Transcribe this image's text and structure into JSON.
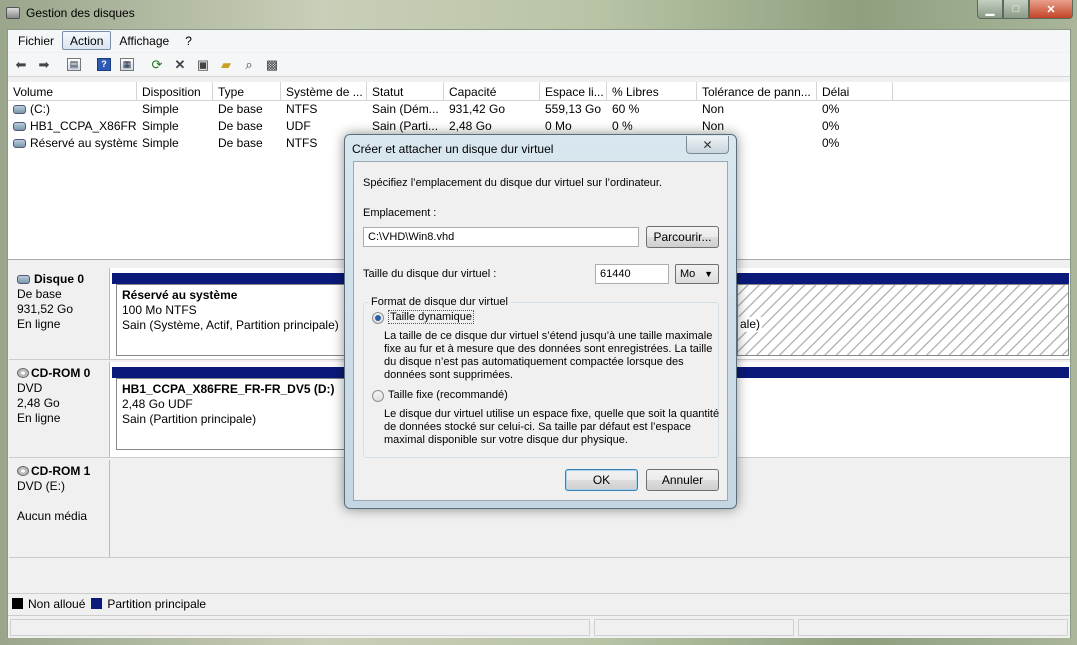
{
  "window": {
    "title": "Gestion des disques",
    "min": "▁",
    "max": "□",
    "close": "✕"
  },
  "menu": [
    "Fichier",
    "Action",
    "Affichage",
    "?"
  ],
  "columns": [
    "Volume",
    "Disposition",
    "Type",
    "Système de ...",
    "Statut",
    "Capacité",
    "Espace li...",
    "% Libres",
    "Tolérance de pann...",
    "Délai"
  ],
  "volumes": [
    [
      "(C:)",
      "Simple",
      "De base",
      "NTFS",
      "Sain (Dém...",
      "931,42 Go",
      "559,13 Go",
      "60 %",
      "Non",
      "0%"
    ],
    [
      "HB1_CCPA_X86FR...",
      "Simple",
      "De base",
      "UDF",
      "Sain (Parti...",
      "2,48 Go",
      "0 Mo",
      "0 %",
      "Non",
      "0%"
    ],
    [
      "Réservé au système",
      "Simple",
      "De base",
      "NTFS",
      "",
      "",
      "",
      "",
      "",
      "0%"
    ]
  ],
  "disks": {
    "disk0": {
      "name": "Disque 0",
      "type": "De base",
      "size": "931,52 Go",
      "status": "En ligne",
      "part_name": "Réservé au système",
      "part_size": "100 Mo NTFS",
      "part_status": "Sain (Système, Actif, Partition principale)",
      "tail": "ale)"
    },
    "cd0": {
      "name": "CD-ROM 0",
      "type": "DVD",
      "size": "2,48 Go",
      "status": "En ligne",
      "part_name": "HB1_CCPA_X86FRE_FR-FR_DV5  (D:)",
      "part_size": "2,48 Go UDF",
      "part_status": "Sain (Partition principale)"
    },
    "cd1": {
      "name": "CD-ROM 1",
      "type": "DVD (E:)",
      "status": "Aucun média"
    }
  },
  "legend": {
    "unallocated": "Non alloué",
    "primary": "Partition principale",
    "unallocated_color": "#000000",
    "primary_color": "#0b1a7a"
  },
  "dialog": {
    "title": "Créer et attacher un disque dur virtuel",
    "close": "✕",
    "intro": "Spécifiez l’emplacement du disque dur virtuel sur l’ordinateur.",
    "location_label": "Emplacement :",
    "location_value": "C:\\VHD\\Win8.vhd",
    "browse": "Parcourir...",
    "size_label": "Taille du disque dur virtuel :",
    "size_value": "61440",
    "unit": "Mo",
    "format_group": "Format de disque dur virtuel",
    "dynamic_label": "Taille dynamique",
    "dynamic_desc_1": "La taille de ce disque dur virtuel s’étend jusqu’à une taille maximale",
    "dynamic_desc_2": "fixe au fur et à mesure que des données sont enregistrées. La taille",
    "dynamic_desc_3": "du disque n’est pas automatiquement compactée lorsque des",
    "dynamic_desc_4": "données sont supprimées.",
    "fixed_label": "Taille fixe (recommandé)",
    "fixed_desc_1": "Le disque dur virtuel utilise un espace fixe, quelle que soit la quantité",
    "fixed_desc_2": "de données stocké sur celui-ci. Sa taille par défaut est l’espace",
    "fixed_desc_3": "maximal disponible sur votre disque dur physique.",
    "ok": "OK",
    "cancel": "Annuler"
  }
}
